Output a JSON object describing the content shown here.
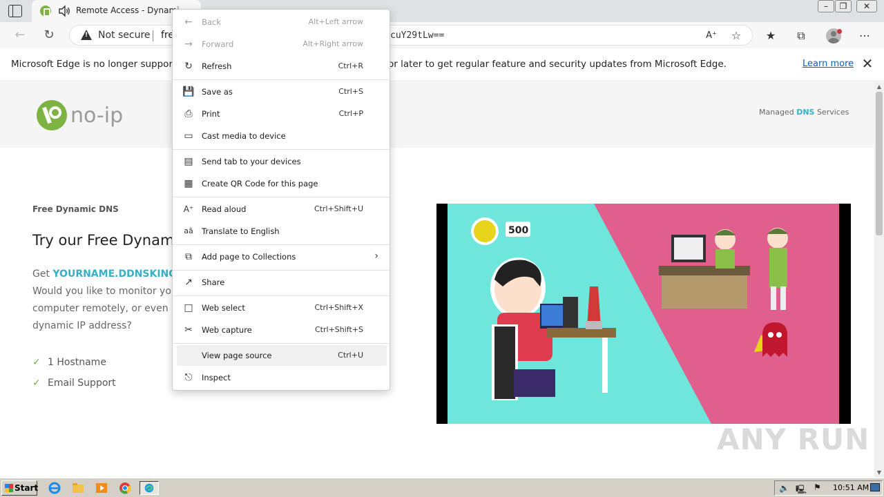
{
  "browser": {
    "tab_title": "Remote Access - Dynamic DNS",
    "address": {
      "security_label": "Not secure",
      "url_visible_start": "fre",
      "url_visible_end": "cuY29tLw=="
    }
  },
  "infobar": {
    "text_before_menu": "Microsoft Edge is no longer supported",
    "text_after_menu": "or later to get regular feature and security updates from Microsoft Edge.",
    "learn_more": "Learn more"
  },
  "page": {
    "logo_text": "no-ip",
    "managed_prefix": "Managed ",
    "managed_highlight": "DNS",
    "managed_suffix": " Services",
    "eyebrow": "Free Dynamic DNS",
    "title_partial": "Try our Free Dynamic",
    "get_prefix": "Get ",
    "get_highlight": "YOURNAME.DDNSKING.C",
    "p_line_2": "Would you like to monitor your h",
    "p_line_3": "computer remotely, or even run",
    "p_line_4": "dynamic IP address?",
    "features": [
      "1 Hostname",
      "Email Support"
    ],
    "video_score": "500"
  },
  "context_menu": {
    "items": [
      {
        "icon": "back-arrow-icon",
        "label": "Back",
        "shortcut": "Alt+Left arrow",
        "disabled": true
      },
      {
        "icon": "forward-arrow-icon",
        "label": "Forward",
        "shortcut": "Alt+Right arrow",
        "disabled": true
      },
      {
        "icon": "refresh-icon",
        "label": "Refresh",
        "shortcut": "Ctrl+R"
      },
      {
        "icon": "save-icon",
        "label": "Save as",
        "shortcut": "Ctrl+S"
      },
      {
        "icon": "print-icon",
        "label": "Print",
        "shortcut": "Ctrl+P"
      },
      {
        "icon": "cast-icon",
        "label": "Cast media to device",
        "shortcut": ""
      },
      {
        "icon": "send-tab-icon",
        "label": "Send tab to your devices",
        "shortcut": ""
      },
      {
        "icon": "qr-code-icon",
        "label": "Create QR Code for this page",
        "shortcut": ""
      },
      {
        "icon": "read-aloud-icon",
        "label": "Read aloud",
        "shortcut": "Ctrl+Shift+U"
      },
      {
        "icon": "translate-icon",
        "label": "Translate to English",
        "shortcut": ""
      },
      {
        "icon": "collections-icon",
        "label": "Add page to Collections",
        "shortcut": ""
      },
      {
        "icon": "share-icon",
        "label": "Share",
        "shortcut": ""
      },
      {
        "icon": "web-select-icon",
        "label": "Web select",
        "shortcut": "Ctrl+Shift+X"
      },
      {
        "icon": "web-capture-icon",
        "label": "Web capture",
        "shortcut": "Ctrl+Shift+S"
      },
      {
        "icon": "view-source-icon",
        "label": "View page source",
        "shortcut": "Ctrl+U",
        "hover": true
      },
      {
        "icon": "inspect-icon",
        "label": "Inspect",
        "shortcut": ""
      }
    ]
  },
  "taskbar": {
    "start_label": "Start",
    "clock": "10:51 AM"
  },
  "watermark": "ANY RUN"
}
